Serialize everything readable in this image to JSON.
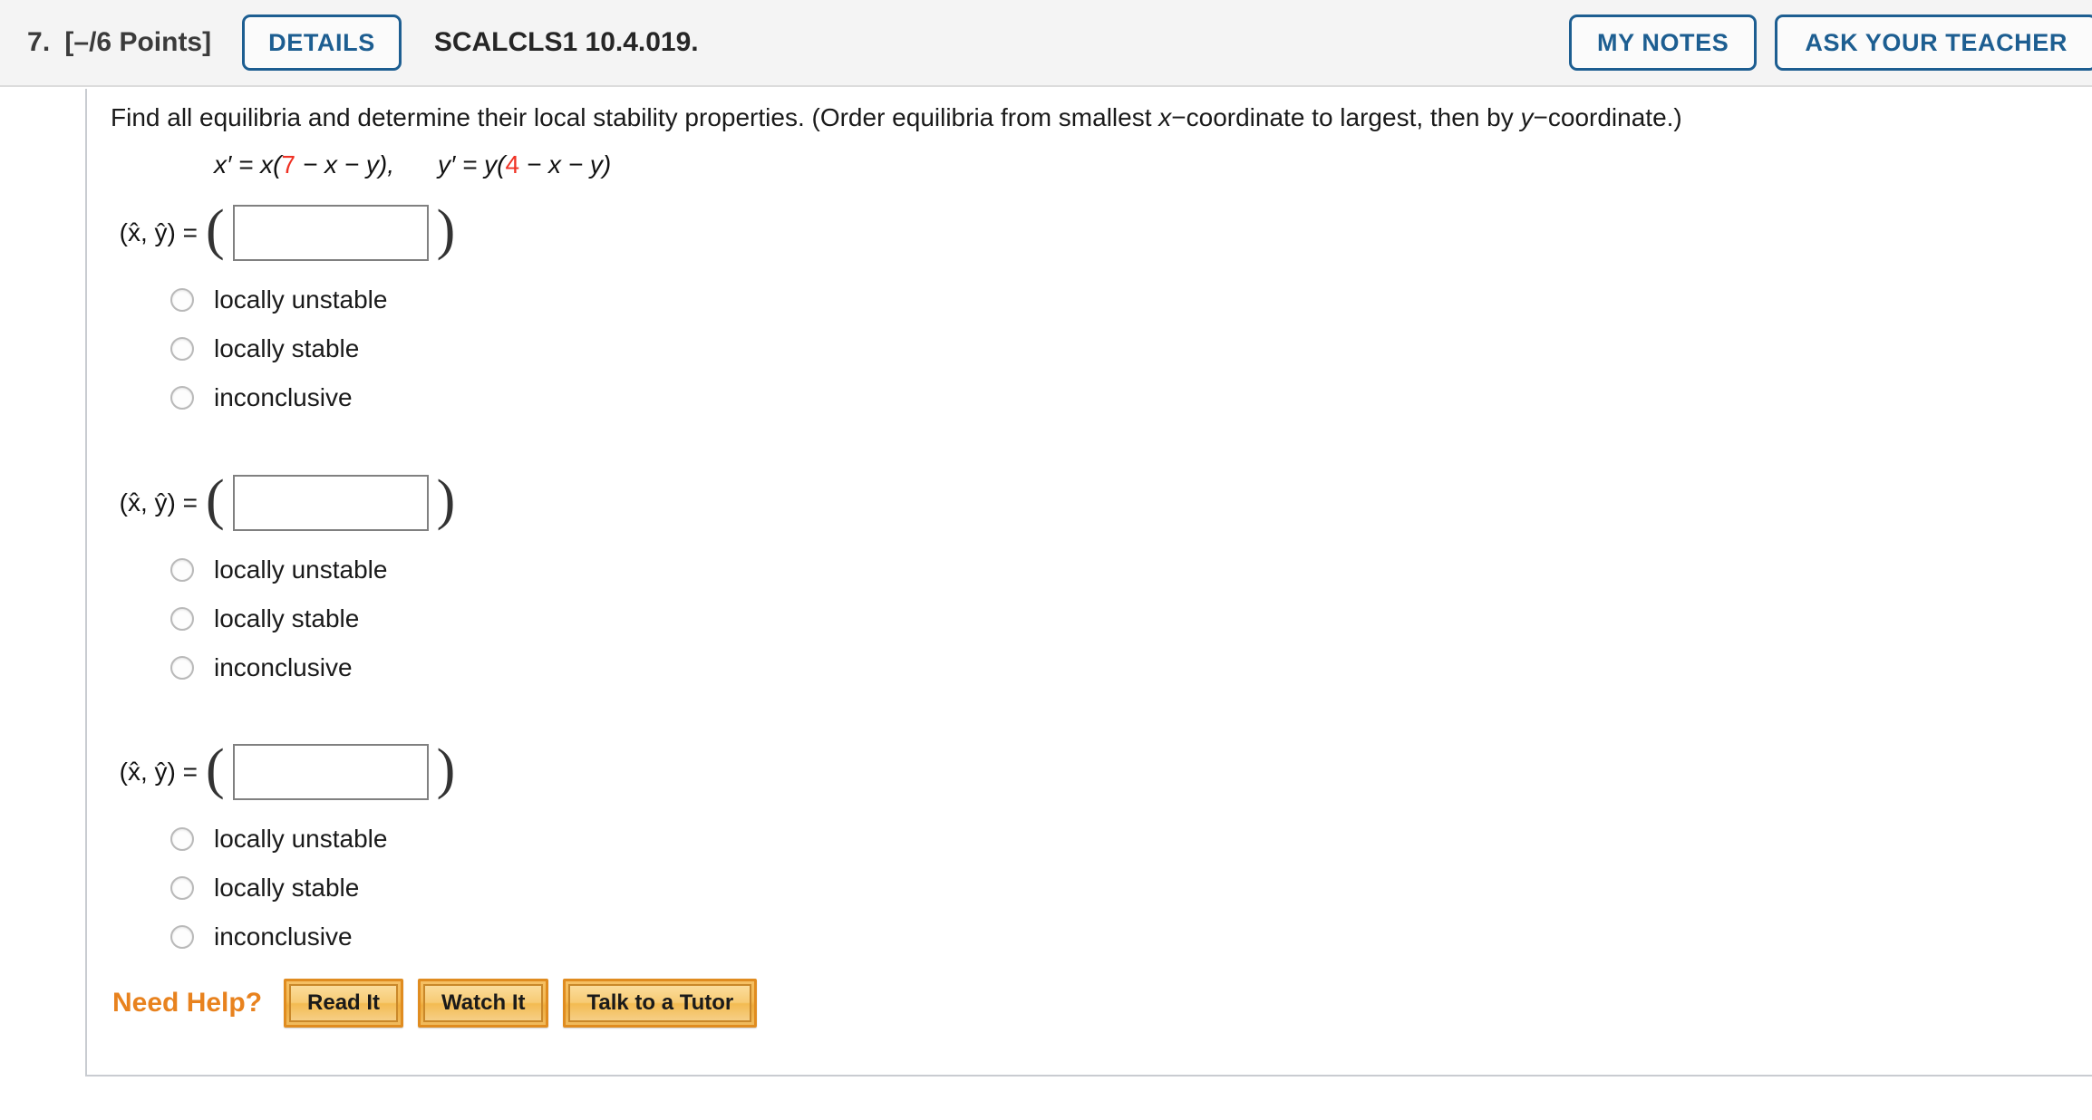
{
  "header": {
    "question_number": "7.",
    "points": "[–/6 Points]",
    "details_label": "DETAILS",
    "assignment_code": "SCALCLS1 10.4.019.",
    "my_notes_label": "MY NOTES",
    "ask_teacher_label": "ASK YOUR TEACHER",
    "accent_blue": "#1d5e91",
    "background": "#f4f4f4"
  },
  "question": {
    "prompt_part1": "Find all equilibria and determine their local stability properties. (Order equilibria from smallest ",
    "prompt_var1": "x",
    "prompt_part2": "−coordinate  to largest, then by ",
    "prompt_var2": "y",
    "prompt_part3": "−coordinate.)",
    "equation": {
      "lhs1": "x′ = x(",
      "coef1": "7",
      "rhs1": " − x − y),",
      "lhs2": "y′ = y(",
      "coef2": "4",
      "rhs2": " − x − y)",
      "coefficient_color": "#ef3124"
    }
  },
  "answers": [
    {
      "label": "(x̂, ŷ) =",
      "open_paren": "(",
      "close_paren": ")",
      "value": "",
      "placeholder": "",
      "options": [
        {
          "label": "locally unstable",
          "selected": false
        },
        {
          "label": "locally stable",
          "selected": false
        },
        {
          "label": "inconclusive",
          "selected": false
        }
      ]
    },
    {
      "label": "(x̂, ŷ) =",
      "open_paren": "(",
      "close_paren": ")",
      "value": "",
      "placeholder": "",
      "options": [
        {
          "label": "locally unstable",
          "selected": false
        },
        {
          "label": "locally stable",
          "selected": false
        },
        {
          "label": "inconclusive",
          "selected": false
        }
      ]
    },
    {
      "label": "(x̂, ŷ) =",
      "open_paren": "(",
      "close_paren": ")",
      "value": "",
      "placeholder": "",
      "options": [
        {
          "label": "locally unstable",
          "selected": false
        },
        {
          "label": "locally stable",
          "selected": false
        },
        {
          "label": "inconclusive",
          "selected": false
        }
      ]
    }
  ],
  "need_help": {
    "label": "Need Help?",
    "label_color": "#e8821e",
    "buttons": [
      {
        "label": "Read It"
      },
      {
        "label": "Watch It"
      },
      {
        "label": "Talk to a Tutor"
      }
    ]
  }
}
